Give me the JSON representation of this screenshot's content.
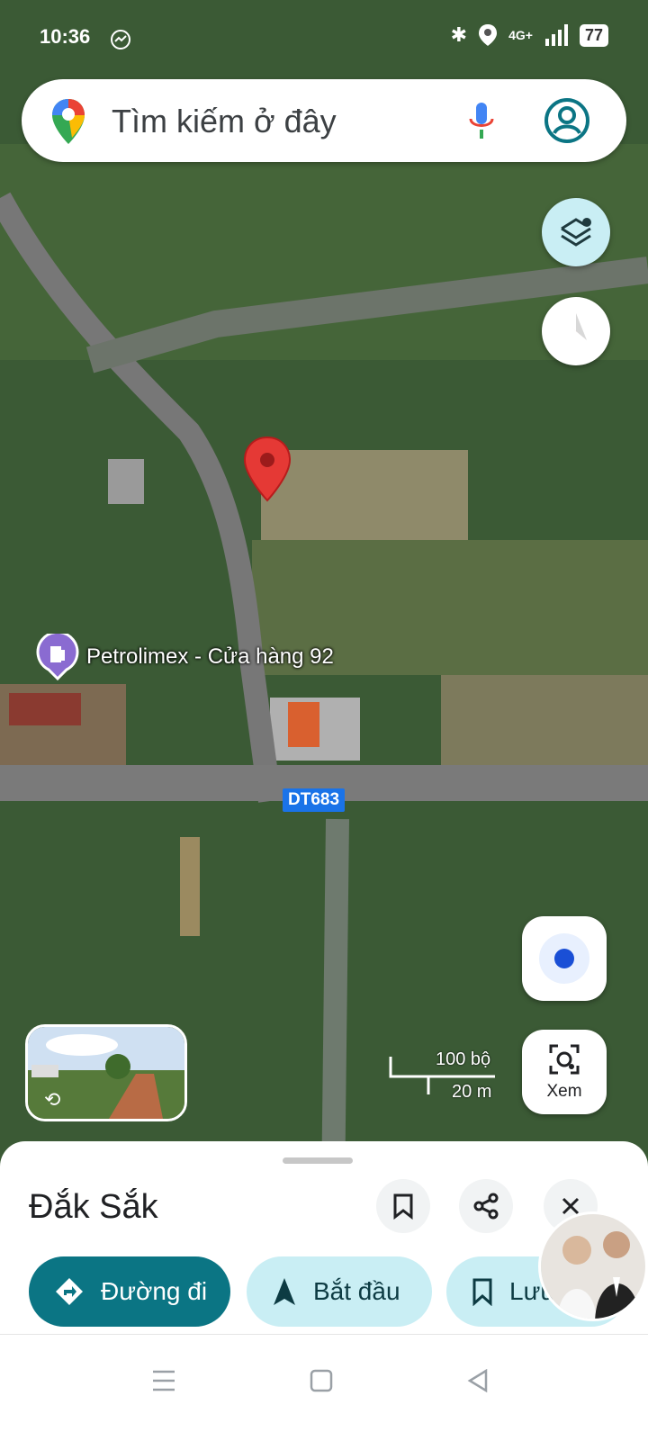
{
  "status_bar": {
    "time": "10:36",
    "battery": "77",
    "network": "4G+"
  },
  "search": {
    "placeholder": "Tìm kiếm ở đây"
  },
  "map": {
    "poi_label": "Petrolimex - Cửa hàng 92",
    "road_label": "DT683",
    "scale_feet": "100 bộ",
    "scale_meters": "20 m"
  },
  "lens_button": {
    "label": "Xem"
  },
  "place_sheet": {
    "title": "Đắk Sắk",
    "chips": [
      {
        "label": "Đường đi"
      },
      {
        "label": "Bắt đầu"
      },
      {
        "label": "Lưu"
      }
    ]
  },
  "colors": {
    "accent": "#0b7584",
    "chip_light": "#c9eef4",
    "pin_red": "#e53935",
    "road_shield": "#1a73e8"
  }
}
